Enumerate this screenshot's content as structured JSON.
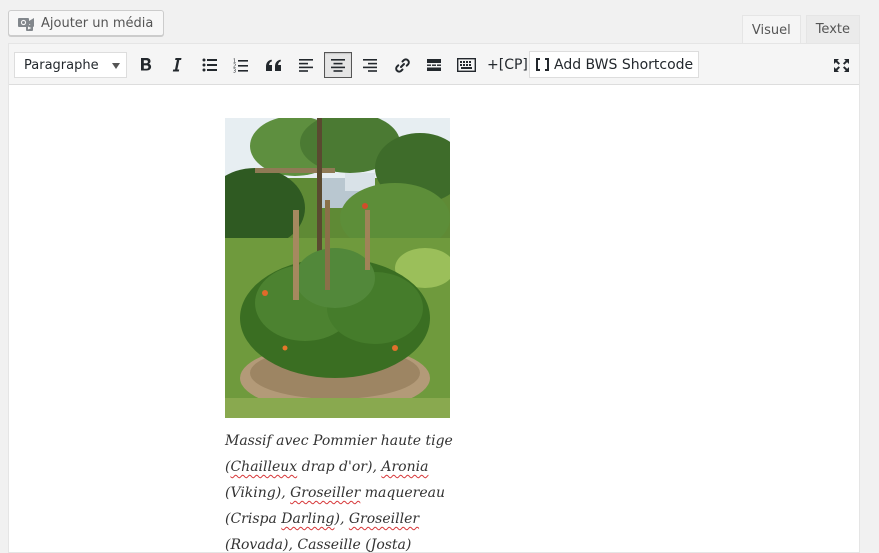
{
  "media": {
    "label": "Ajouter un média",
    "icon": "media-camera-icon"
  },
  "tabs": [
    {
      "label": "Visuel",
      "active": true
    },
    {
      "label": "Texte",
      "active": false
    }
  ],
  "toolbar": {
    "format_select": "Paragraphe",
    "buttons": [
      "bold-icon",
      "italic-icon",
      "bullet-list-icon",
      "numbered-list-icon",
      "blockquote-icon",
      "align-left-icon",
      "align-center-icon",
      "align-right-icon",
      "link-icon",
      "read-more-icon",
      "keyboard-icon",
      "fullscreen-icon"
    ],
    "cp_label": "+[CP]",
    "bws_label": "Add BWS Shortcode",
    "active_button": "align-center-icon"
  },
  "content": {
    "caption": {
      "l1": "Massif avec Pommier haute tige",
      "l2a": "(",
      "l2b": "Chailleux",
      "l2c": " drap d'or), ",
      "l2d": "Aronia",
      "l3a": "(Viking), ",
      "l3b": "Groseiller",
      "l3c": " maquereau",
      "l4a": "(Crispa ",
      "l4b": "Darling",
      "l4c": "), ",
      "l4d": "Groseiller",
      "l5": "(Rovada), Casseille (Josta)"
    }
  },
  "colors": {
    "accent": "#0073aa",
    "spell_error": "#d63638"
  }
}
